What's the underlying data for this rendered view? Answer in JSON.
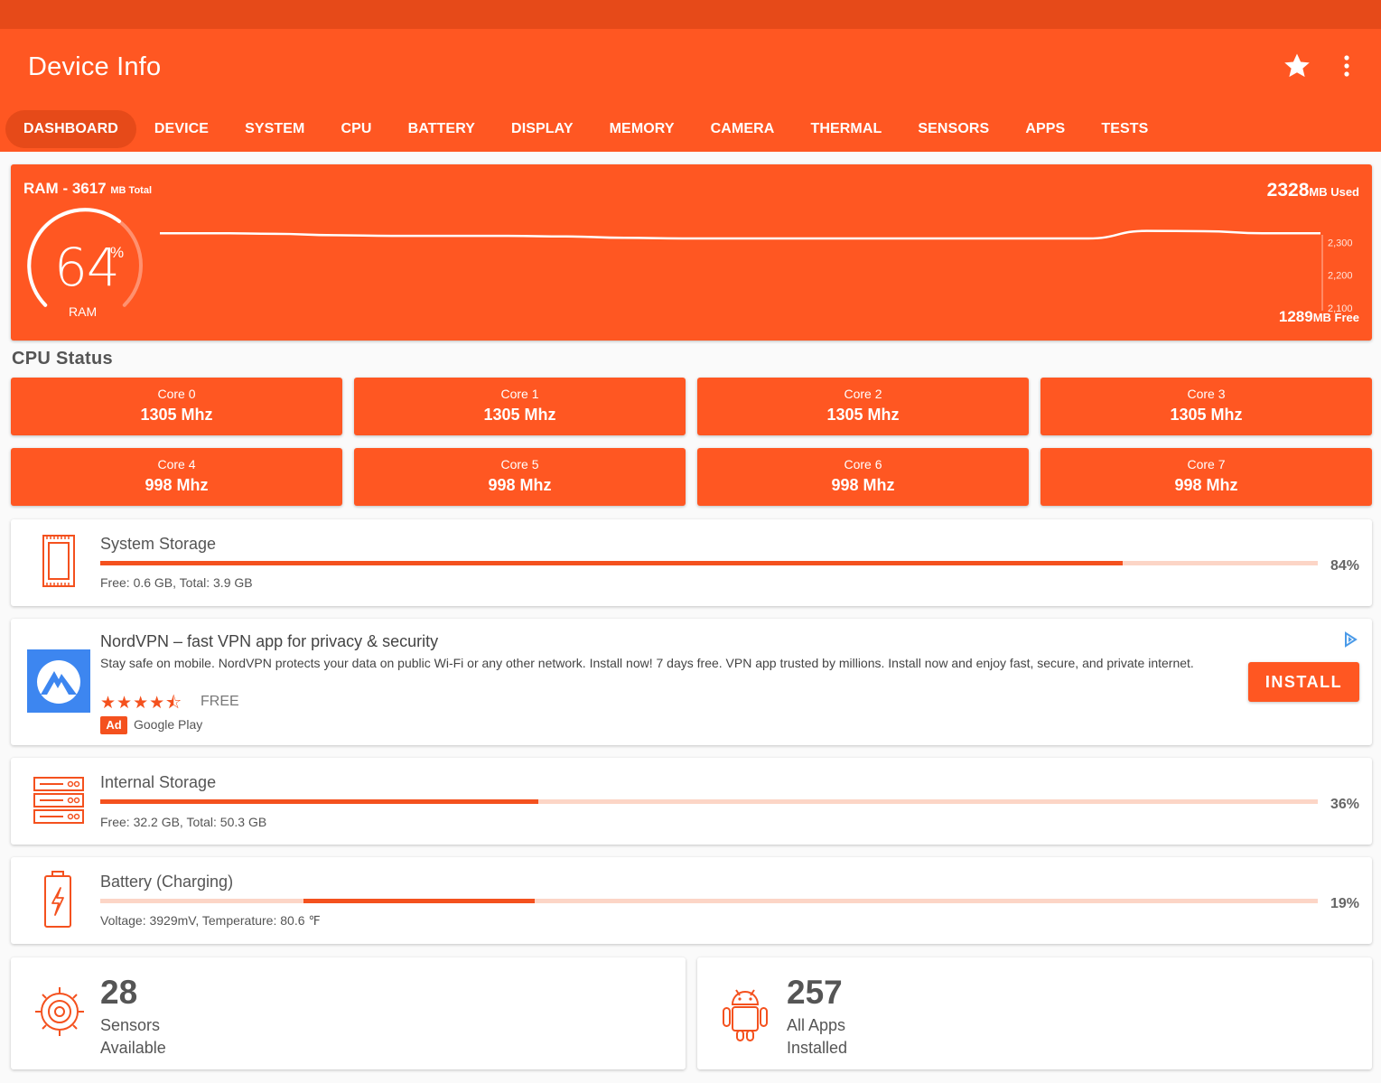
{
  "app": {
    "title": "Device Info"
  },
  "toolbar": {
    "favorite_icon": "star-icon",
    "overflow_icon": "more-vert-icon"
  },
  "tabs": [
    {
      "label": "DASHBOARD",
      "active": true
    },
    {
      "label": "DEVICE"
    },
    {
      "label": "SYSTEM"
    },
    {
      "label": "CPU"
    },
    {
      "label": "BATTERY"
    },
    {
      "label": "DISPLAY"
    },
    {
      "label": "MEMORY"
    },
    {
      "label": "CAMERA"
    },
    {
      "label": "THERMAL"
    },
    {
      "label": "SENSORS"
    },
    {
      "label": "APPS"
    },
    {
      "label": "TESTS"
    }
  ],
  "ram": {
    "title_prefix": "RAM - 3617",
    "title_unit": "MB Total",
    "used_value": "2328",
    "used_unit": "MB Used",
    "free_value": "1289",
    "free_unit": "MB Free",
    "percent": "64",
    "percent_symbol": "%",
    "gauge_label": "RAM",
    "usage_fraction": 0.64
  },
  "chart_data": {
    "type": "line",
    "title": "",
    "ylabel": "",
    "xlabel": "",
    "yticks": [
      "2,300",
      "2,200",
      "2,100"
    ],
    "ylim": [
      2070,
      2400
    ],
    "x": [
      0,
      5,
      10,
      15,
      20,
      25,
      30,
      35,
      40,
      45,
      50,
      55,
      60,
      65,
      70,
      75,
      80,
      85,
      90,
      95,
      100
    ],
    "values": [
      2328,
      2328,
      2326,
      2322,
      2320,
      2320,
      2320,
      2318,
      2314,
      2312,
      2312,
      2312,
      2312,
      2312,
      2312,
      2312,
      2312,
      2335,
      2334,
      2328,
      2328
    ]
  },
  "cpu": {
    "section_title": "CPU Status",
    "cores": [
      {
        "name": "Core 0",
        "freq": "1305 Mhz"
      },
      {
        "name": "Core 1",
        "freq": "1305 Mhz"
      },
      {
        "name": "Core 2",
        "freq": "1305 Mhz"
      },
      {
        "name": "Core 3",
        "freq": "1305 Mhz"
      },
      {
        "name": "Core 4",
        "freq": "998 Mhz"
      },
      {
        "name": "Core 5",
        "freq": "998 Mhz"
      },
      {
        "name": "Core 6",
        "freq": "998 Mhz"
      },
      {
        "name": "Core 7",
        "freq": "998 Mhz"
      }
    ]
  },
  "system_storage": {
    "title": "System Storage",
    "details": "Free: 0.6 GB,  Total: 3.9 GB",
    "percent": "84%",
    "fill": 0.84
  },
  "ad": {
    "title": "NordVPN – fast VPN app for privacy & security",
    "description": "Stay safe on mobile. NordVPN protects your data on public Wi-Fi or any other network. Install now! 7 days free. VPN app trusted by millions. Install now and enjoy fast, secure, and private internet.",
    "stars": "★★★★⯪",
    "rating": 4.5,
    "price": "FREE",
    "badge": "Ad",
    "store": "Google Play",
    "install_label": "INSTALL"
  },
  "internal_storage": {
    "title": "Internal Storage",
    "details": "Free: 32.2 GB,  Total: 50.3 GB",
    "percent": "36%",
    "fill": 0.36
  },
  "battery": {
    "title": "Battery (Charging)",
    "details": "Voltage: 3929mV,  Temperature: 80.6 ℉",
    "percent": "19%",
    "fill": 0.19
  },
  "sensors": {
    "count": "28",
    "line1": "Sensors",
    "line2": "Available"
  },
  "apps": {
    "count": "257",
    "line1": "All Apps",
    "line2": "Installed"
  },
  "colors": {
    "accent": "#ff5722",
    "status_bar": "#e64a19",
    "bar_track": "#fcd5c6",
    "bar_fill": "#f4511e"
  }
}
